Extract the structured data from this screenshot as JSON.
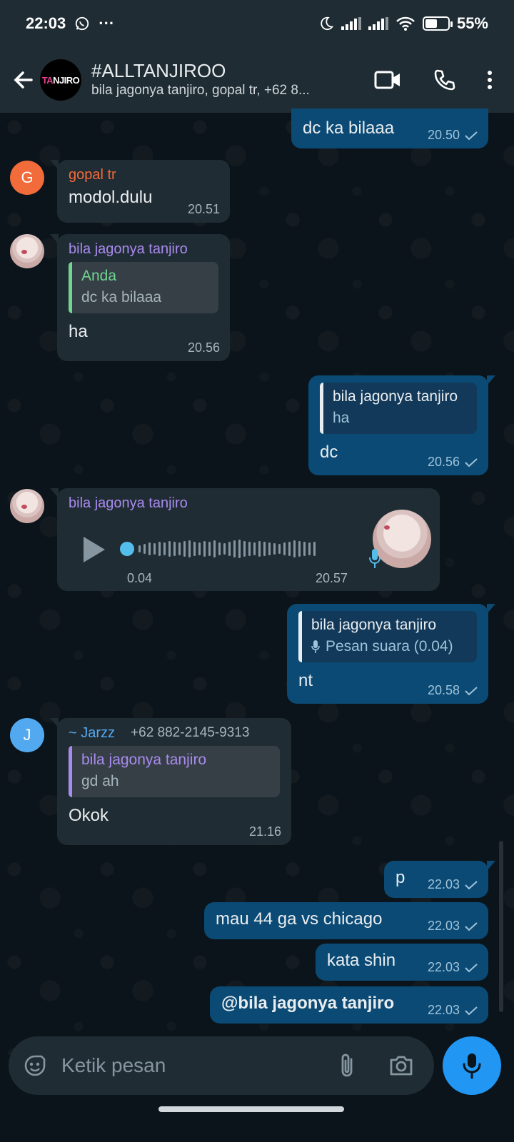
{
  "status_bar": {
    "time": "22:03",
    "dots": "···",
    "battery": "55%",
    "battery_level": 0.55
  },
  "header": {
    "group_name": "#ALLTANJIROO",
    "participants": "bila jagonya tanjiro, gopal tr, +62 8...",
    "avatar_text_pink": "TA",
    "avatar_text": "NJIRO"
  },
  "messages": {
    "m1": {
      "text": "dc ka bilaaa",
      "time": "20.50"
    },
    "m2": {
      "sender": "gopal tr",
      "avatar_letter": "G",
      "text": "modol.dulu",
      "time": "20.51"
    },
    "m3": {
      "sender": "bila jagonya tanjiro",
      "quote_name": "Anda",
      "quote_text": "dc ka bilaaa",
      "text": "ha",
      "time": "20.56"
    },
    "m4": {
      "quote_name": "bila jagonya tanjiro",
      "quote_text": "ha",
      "text": "dc",
      "time": "20.56"
    },
    "m5": {
      "sender": "bila jagonya tanjiro",
      "duration": "0.04",
      "time": "20.57"
    },
    "m6": {
      "quote_name": "bila jagonya tanjiro",
      "quote_text": "Pesan suara (0.04)",
      "text": "nt",
      "time": "20.58"
    },
    "m7": {
      "sender": "~ Jarzz",
      "phone": "+62 882-2145-9313",
      "avatar_letter": "J",
      "quote_name": "bila jagonya tanjiro",
      "quote_text": "gd ah",
      "text": "Okok",
      "time": "21.16"
    },
    "m8": {
      "text": "p",
      "time": "22.03"
    },
    "m9": {
      "text": "mau 44 ga vs chicago",
      "time": "22.03"
    },
    "m10": {
      "text": "kata shin",
      "time": "22.03"
    },
    "m11": {
      "text": "@bila jagonya tanjiro",
      "time": "22.03"
    }
  },
  "input": {
    "placeholder": "Ketik pesan"
  },
  "colors": {
    "accent": "#2196f3",
    "gopal": "#f26b3a",
    "bila": "#a98bf0",
    "jarzz": "#53a9f0",
    "anda": "#71d492"
  }
}
